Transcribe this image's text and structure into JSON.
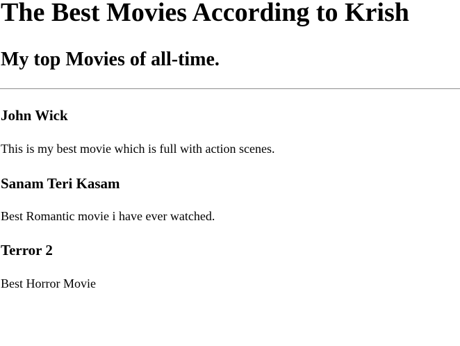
{
  "page": {
    "title": "The Best Movies According to Krish",
    "subtitle": "My top Movies of all-time."
  },
  "movies": [
    {
      "title": "John Wick",
      "description": "This is my best movie which is full with action scenes."
    },
    {
      "title": "Sanam Teri Kasam",
      "description": "Best Romantic movie i have ever watched."
    },
    {
      "title": "Terror 2",
      "description": "Best Horror Movie"
    }
  ]
}
